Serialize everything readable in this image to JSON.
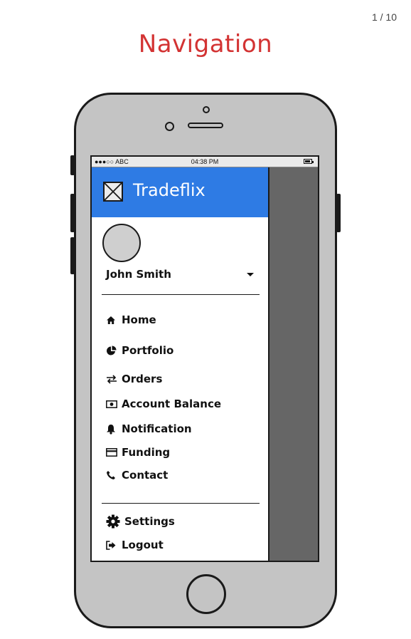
{
  "page": {
    "counter": "1 / 10",
    "title": "Navigation"
  },
  "status_bar": {
    "signal": "●●●○○ ABC",
    "time": "04:38 PM"
  },
  "drawer": {
    "app_name": "Tradeflix",
    "user_name": "John Smith",
    "menu": [
      {
        "label": "Home",
        "icon": "home-icon"
      },
      {
        "label": "Portfolio",
        "icon": "pie-chart-icon"
      },
      {
        "label": "Orders",
        "icon": "exchange-arrows-icon"
      },
      {
        "label": "Account Balance",
        "icon": "money-icon"
      },
      {
        "label": "Notification",
        "icon": "bell-icon"
      },
      {
        "label": "Funding",
        "icon": "credit-card-icon"
      },
      {
        "label": "Contact",
        "icon": "phone-icon"
      }
    ],
    "footer_menu": [
      {
        "label": "Settings",
        "icon": "gear-icon"
      },
      {
        "label": "Logout",
        "icon": "logout-icon"
      }
    ]
  },
  "colors": {
    "title": "#d33333",
    "header": "#2e7be4",
    "overlay": "#666666",
    "phone_body": "#c4c4c4"
  }
}
